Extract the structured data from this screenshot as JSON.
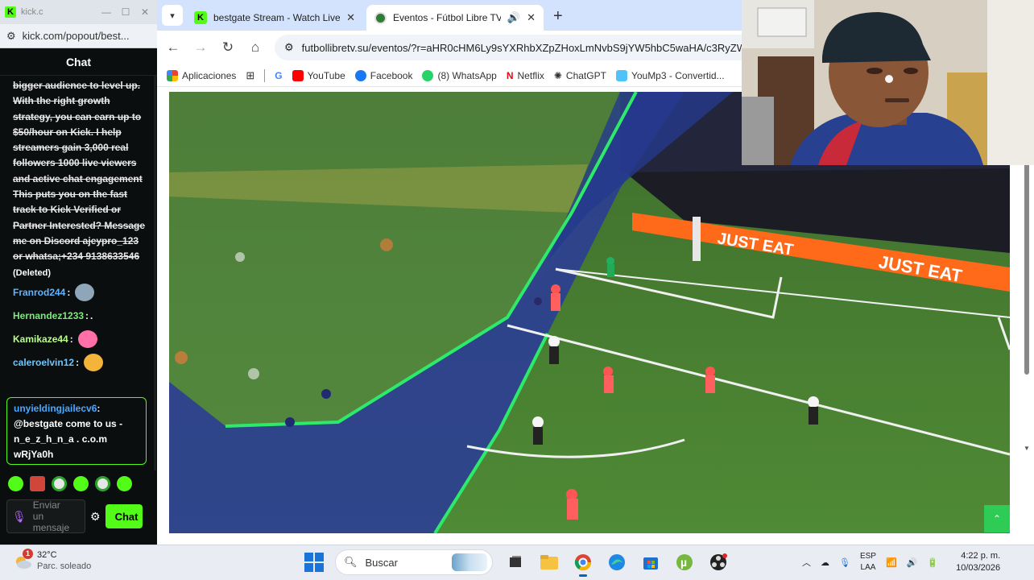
{
  "kick_window": {
    "tab_title": "kick.c",
    "url": "kick.com/popout/best...",
    "chat_header": "Chat",
    "deleted_message": "bigger audience to level up. With the right growth strategy, you can earn up to $50/hour on Kick. I help streamers gain 3,000 real followers 1000 live viewers and active chat engagement This puts you on the fast track to Kick Verified or Partner Interested? Message me on Discord ajeypro_123 or whatsa;+234 9138633546",
    "deleted_tag": "(Deleted)",
    "messages": [
      {
        "user": "Franrod244",
        "text": ""
      },
      {
        "user": "Hernandez1233",
        "text": " ."
      },
      {
        "user": "Kamikaze44",
        "text": ""
      },
      {
        "user": "caleroelvin12",
        "text": ""
      }
    ],
    "highlight": {
      "user": "unyieldingjailecv6",
      "text": "@bestgate come to us - n_e_z_h_n_a . c.o.m wRjYa0h"
    },
    "input_placeholder": "Enviar un mensaje",
    "chat_button": "Chat"
  },
  "browser": {
    "tabs": [
      {
        "title": "bestgate Stream - Watch Live o",
        "icon": "kick-favicon"
      },
      {
        "title": "Eventos - Fútbol Libre TV",
        "icon": "soccer-ball-favicon"
      }
    ],
    "url": "futbollibretv.su/eventos/?r=aHR0cHM6Ly9sYXRhbXZpZHoxLmNvbS9jYW5hbC5waHA/c3RyZW",
    "bookmarks": [
      "Aplicaciones",
      "YouTube",
      "Facebook",
      "(8) WhatsApp",
      "Netflix",
      "ChatGPT",
      "YouMp3 - Convertid..."
    ],
    "ad_boards": [
      "JUST EAT",
      "JUST EAT"
    ],
    "colors": {
      "tab_strip": "#d3e3fd",
      "kick_green": "#53fc18",
      "back_to_top": "#2ecc55"
    }
  },
  "taskbar": {
    "weather_temp": "32°C",
    "weather_desc": "Parc. soleado",
    "weather_badge": "1",
    "search_placeholder": "Buscar",
    "lang_top": "ESP",
    "lang_bottom": "LAA",
    "time": "4:22 p. m.",
    "date": "10/03/2026"
  }
}
